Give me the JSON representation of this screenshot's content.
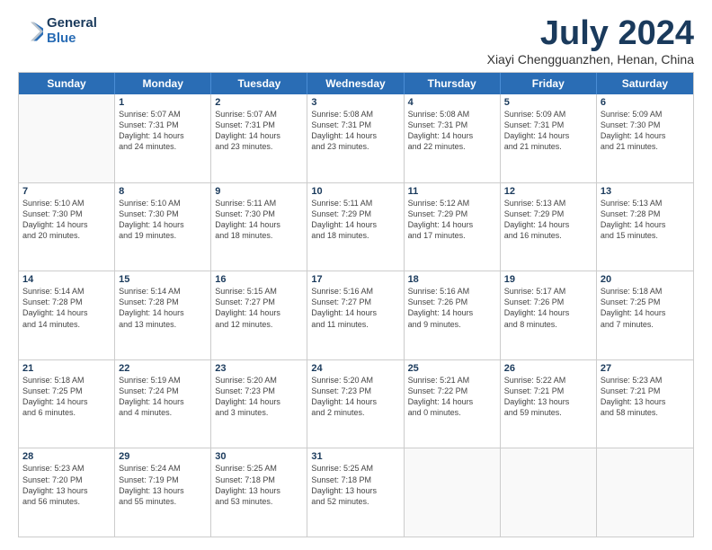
{
  "logo": {
    "line1": "General",
    "line2": "Blue"
  },
  "title": "July 2024",
  "subtitle": "Xiayi Chengguanzhen, Henan, China",
  "header_days": [
    "Sunday",
    "Monday",
    "Tuesday",
    "Wednesday",
    "Thursday",
    "Friday",
    "Saturday"
  ],
  "weeks": [
    [
      {
        "day": "",
        "info": ""
      },
      {
        "day": "1",
        "info": "Sunrise: 5:07 AM\nSunset: 7:31 PM\nDaylight: 14 hours\nand 24 minutes."
      },
      {
        "day": "2",
        "info": "Sunrise: 5:07 AM\nSunset: 7:31 PM\nDaylight: 14 hours\nand 23 minutes."
      },
      {
        "day": "3",
        "info": "Sunrise: 5:08 AM\nSunset: 7:31 PM\nDaylight: 14 hours\nand 23 minutes."
      },
      {
        "day": "4",
        "info": "Sunrise: 5:08 AM\nSunset: 7:31 PM\nDaylight: 14 hours\nand 22 minutes."
      },
      {
        "day": "5",
        "info": "Sunrise: 5:09 AM\nSunset: 7:31 PM\nDaylight: 14 hours\nand 21 minutes."
      },
      {
        "day": "6",
        "info": "Sunrise: 5:09 AM\nSunset: 7:30 PM\nDaylight: 14 hours\nand 21 minutes."
      }
    ],
    [
      {
        "day": "7",
        "info": "Sunrise: 5:10 AM\nSunset: 7:30 PM\nDaylight: 14 hours\nand 20 minutes."
      },
      {
        "day": "8",
        "info": "Sunrise: 5:10 AM\nSunset: 7:30 PM\nDaylight: 14 hours\nand 19 minutes."
      },
      {
        "day": "9",
        "info": "Sunrise: 5:11 AM\nSunset: 7:30 PM\nDaylight: 14 hours\nand 18 minutes."
      },
      {
        "day": "10",
        "info": "Sunrise: 5:11 AM\nSunset: 7:29 PM\nDaylight: 14 hours\nand 18 minutes."
      },
      {
        "day": "11",
        "info": "Sunrise: 5:12 AM\nSunset: 7:29 PM\nDaylight: 14 hours\nand 17 minutes."
      },
      {
        "day": "12",
        "info": "Sunrise: 5:13 AM\nSunset: 7:29 PM\nDaylight: 14 hours\nand 16 minutes."
      },
      {
        "day": "13",
        "info": "Sunrise: 5:13 AM\nSunset: 7:28 PM\nDaylight: 14 hours\nand 15 minutes."
      }
    ],
    [
      {
        "day": "14",
        "info": "Sunrise: 5:14 AM\nSunset: 7:28 PM\nDaylight: 14 hours\nand 14 minutes."
      },
      {
        "day": "15",
        "info": "Sunrise: 5:14 AM\nSunset: 7:28 PM\nDaylight: 14 hours\nand 13 minutes."
      },
      {
        "day": "16",
        "info": "Sunrise: 5:15 AM\nSunset: 7:27 PM\nDaylight: 14 hours\nand 12 minutes."
      },
      {
        "day": "17",
        "info": "Sunrise: 5:16 AM\nSunset: 7:27 PM\nDaylight: 14 hours\nand 11 minutes."
      },
      {
        "day": "18",
        "info": "Sunrise: 5:16 AM\nSunset: 7:26 PM\nDaylight: 14 hours\nand 9 minutes."
      },
      {
        "day": "19",
        "info": "Sunrise: 5:17 AM\nSunset: 7:26 PM\nDaylight: 14 hours\nand 8 minutes."
      },
      {
        "day": "20",
        "info": "Sunrise: 5:18 AM\nSunset: 7:25 PM\nDaylight: 14 hours\nand 7 minutes."
      }
    ],
    [
      {
        "day": "21",
        "info": "Sunrise: 5:18 AM\nSunset: 7:25 PM\nDaylight: 14 hours\nand 6 minutes."
      },
      {
        "day": "22",
        "info": "Sunrise: 5:19 AM\nSunset: 7:24 PM\nDaylight: 14 hours\nand 4 minutes."
      },
      {
        "day": "23",
        "info": "Sunrise: 5:20 AM\nSunset: 7:23 PM\nDaylight: 14 hours\nand 3 minutes."
      },
      {
        "day": "24",
        "info": "Sunrise: 5:20 AM\nSunset: 7:23 PM\nDaylight: 14 hours\nand 2 minutes."
      },
      {
        "day": "25",
        "info": "Sunrise: 5:21 AM\nSunset: 7:22 PM\nDaylight: 14 hours\nand 0 minutes."
      },
      {
        "day": "26",
        "info": "Sunrise: 5:22 AM\nSunset: 7:21 PM\nDaylight: 13 hours\nand 59 minutes."
      },
      {
        "day": "27",
        "info": "Sunrise: 5:23 AM\nSunset: 7:21 PM\nDaylight: 13 hours\nand 58 minutes."
      }
    ],
    [
      {
        "day": "28",
        "info": "Sunrise: 5:23 AM\nSunset: 7:20 PM\nDaylight: 13 hours\nand 56 minutes."
      },
      {
        "day": "29",
        "info": "Sunrise: 5:24 AM\nSunset: 7:19 PM\nDaylight: 13 hours\nand 55 minutes."
      },
      {
        "day": "30",
        "info": "Sunrise: 5:25 AM\nSunset: 7:18 PM\nDaylight: 13 hours\nand 53 minutes."
      },
      {
        "day": "31",
        "info": "Sunrise: 5:25 AM\nSunset: 7:18 PM\nDaylight: 13 hours\nand 52 minutes."
      },
      {
        "day": "",
        "info": ""
      },
      {
        "day": "",
        "info": ""
      },
      {
        "day": "",
        "info": ""
      }
    ]
  ]
}
